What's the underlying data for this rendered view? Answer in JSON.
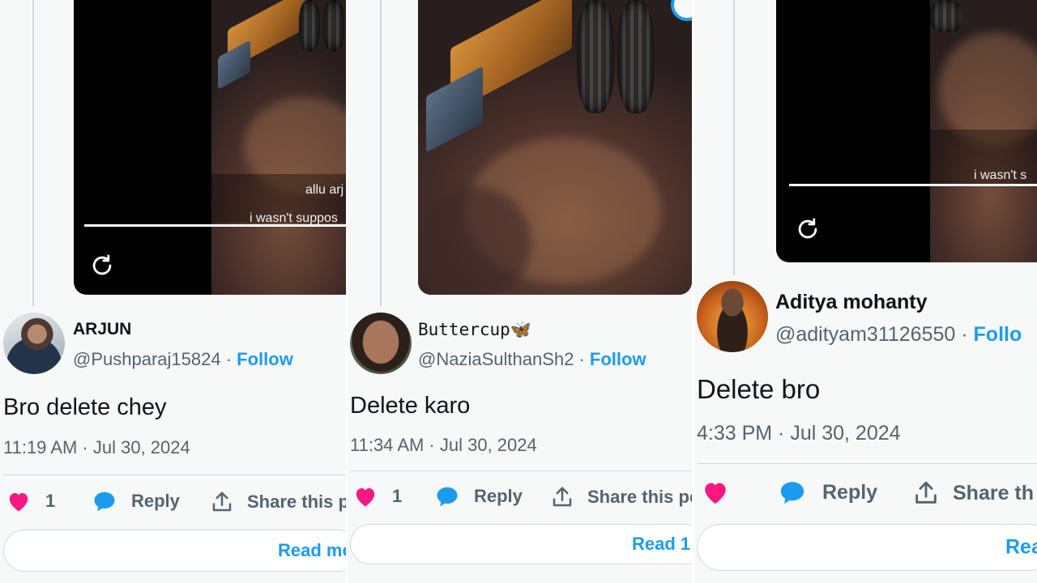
{
  "panels": [
    {
      "video_captions": [
        "allu arj",
        "i wasn't suppos"
      ],
      "author": {
        "name": "ARJUN",
        "handle": "@Pushparaj15824",
        "separator": "·",
        "follow_label": "Follow"
      },
      "tweet_text": "Bro delete chey",
      "timestamp": "11:19 AM · Jul 30, 2024",
      "actions": {
        "like_count": "1",
        "reply_label": "Reply",
        "share_label": "Share this p"
      },
      "read_more_label": "Read mo"
    },
    {
      "video_captions": [],
      "author": {
        "name": "Buttercup🦋",
        "handle": "@NaziaSulthanSh2",
        "separator": "·",
        "follow_label": "Follow"
      },
      "tweet_text": "Delete karo",
      "timestamp": "11:34 AM · Jul 30, 2024",
      "actions": {
        "like_count": "1",
        "reply_label": "Reply",
        "share_label": "Share this po"
      },
      "read_more_label": "Read 1"
    },
    {
      "video_captions": [
        "i wasn't s"
      ],
      "author": {
        "name": "Aditya mohanty",
        "handle": "@adityam31126550",
        "separator": "·",
        "follow_label": "Follo"
      },
      "tweet_text": "Delete bro",
      "timestamp": "4:33 PM · Jul 30, 2024",
      "actions": {
        "like_count": "",
        "reply_label": "Reply",
        "share_label": "Share th"
      },
      "read_more_label": "Rea"
    }
  ],
  "colors": {
    "like_heart": "#f91880",
    "reply_bubble": "#1d9bf0",
    "follow_link": "#1d9bf0",
    "secondary_text": "#536471",
    "primary_text": "#0f1419"
  },
  "icons": [
    "replay-icon",
    "heart-icon",
    "reply-bubble-icon",
    "share-icon"
  ]
}
